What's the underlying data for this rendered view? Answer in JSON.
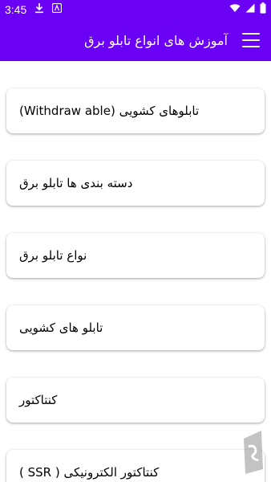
{
  "status_bar": {
    "time": "3:45",
    "icons": [
      "download-icon",
      "app-notification-icon",
      "wifi-icon",
      "signal-icon",
      "battery-icon"
    ]
  },
  "app_bar": {
    "title": "آموزش های انواع تابلو برق",
    "menu_icon": "hamburger-menu-icon"
  },
  "items": [
    {
      "label": "تابلوهای کشویی (Withdraw able)"
    },
    {
      "label": "دسته بندی ها تابلو برق"
    },
    {
      "label": "نواع تابلو برق"
    },
    {
      "label": "تابلو های کشویی"
    },
    {
      "label": "کنتاکتور"
    },
    {
      "label": "( SSR ) کنتاکتور الکترونیکی"
    }
  ],
  "colors": {
    "primary": "#6a00f4",
    "card_bg": "#ffffff",
    "text": "#000000"
  },
  "watermark_icon": "bazaar-logo-icon"
}
